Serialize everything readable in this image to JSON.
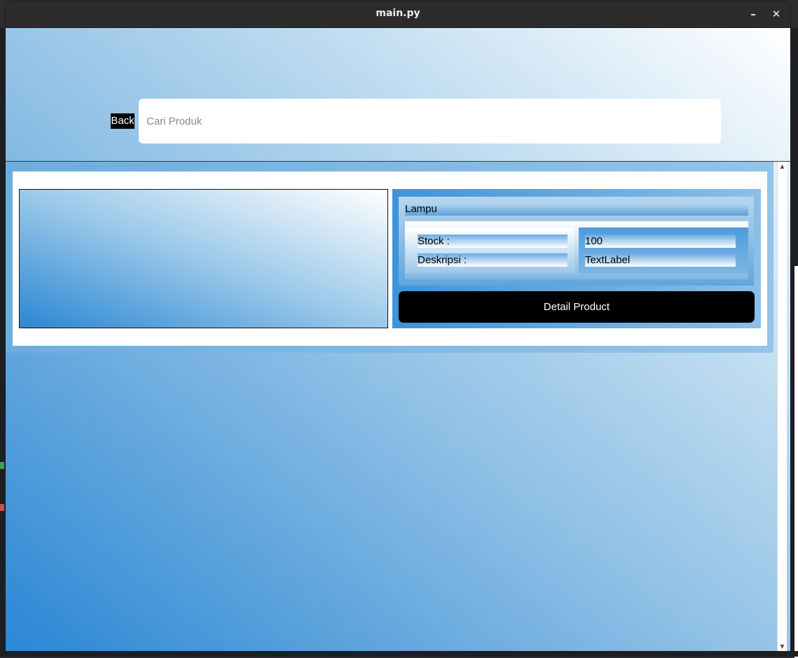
{
  "window": {
    "title": "main.py",
    "minimize_icon": "minimize-icon",
    "close_icon": "close-icon"
  },
  "toolbar": {
    "back_label": "Back",
    "search_placeholder": "Cari Produk",
    "search_value": ""
  },
  "product": {
    "name": "Lampu",
    "stock_label": "Stock :",
    "description_label": "Deskripsi :",
    "stock_value": "100",
    "description_value": "TextLabel",
    "detail_button_label": "Detail Product"
  },
  "colors": {
    "gradient_dark": "#2b87d4",
    "gradient_light": "#ffffff",
    "button_bg": "#000000",
    "button_text": "#ffffff"
  }
}
